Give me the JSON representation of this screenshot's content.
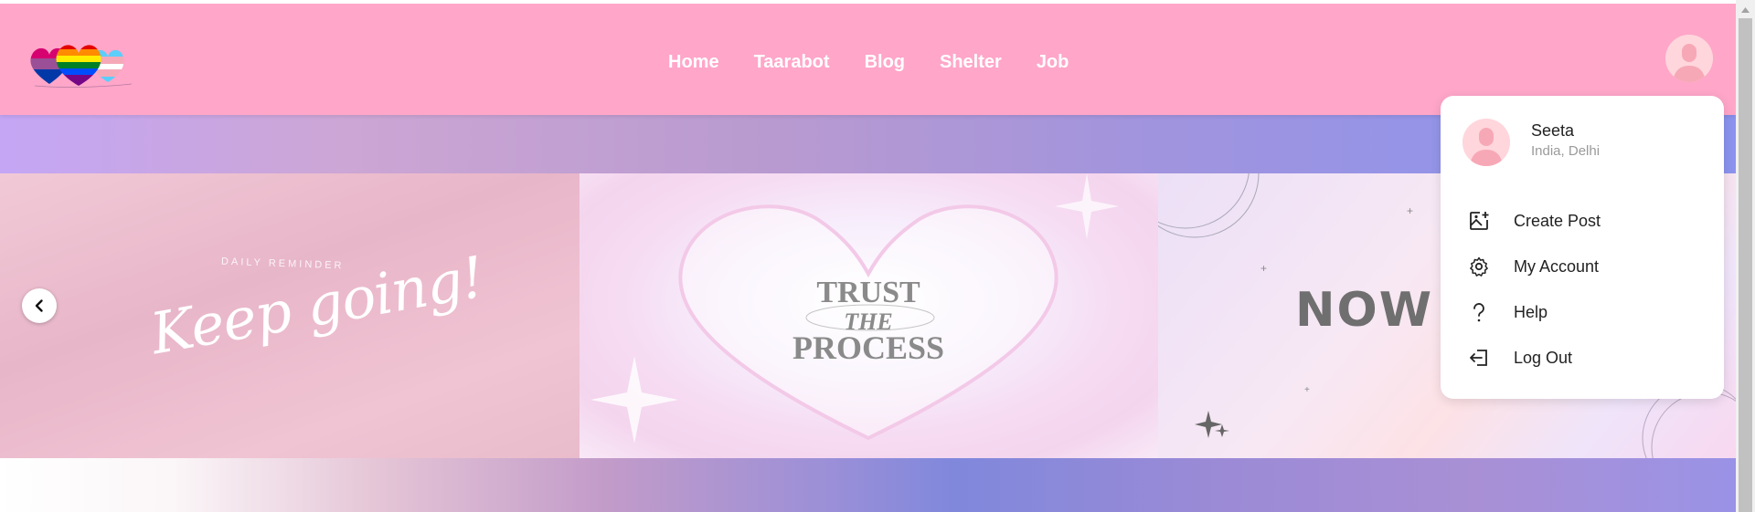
{
  "nav": {
    "items": [
      {
        "label": "Home"
      },
      {
        "label": "Taarabot"
      },
      {
        "label": "Blog"
      },
      {
        "label": "Shelter"
      },
      {
        "label": "Job"
      }
    ]
  },
  "carousel": {
    "slide1": {
      "reminder": "DAILY REMINDER",
      "text": "Keep going!"
    },
    "slide2": {
      "line1": "TRUST",
      "line2": "THE",
      "line3": "PROCESS"
    },
    "slide3": {
      "text": "NOW ON"
    },
    "prev_icon": "chevron-left-icon"
  },
  "profile_menu": {
    "name": "Seeta",
    "location": "India, Delhi",
    "items": [
      {
        "label": "Create Post",
        "icon": "image-add-icon"
      },
      {
        "label": "My Account",
        "icon": "gear-icon"
      },
      {
        "label": "Help",
        "icon": "question-icon"
      },
      {
        "label": "Log Out",
        "icon": "logout-icon"
      }
    ]
  },
  "colors": {
    "header_bg": "#ffa6c9",
    "nav_text": "#ffffff",
    "avatar_bg": "#ffd1d8"
  }
}
